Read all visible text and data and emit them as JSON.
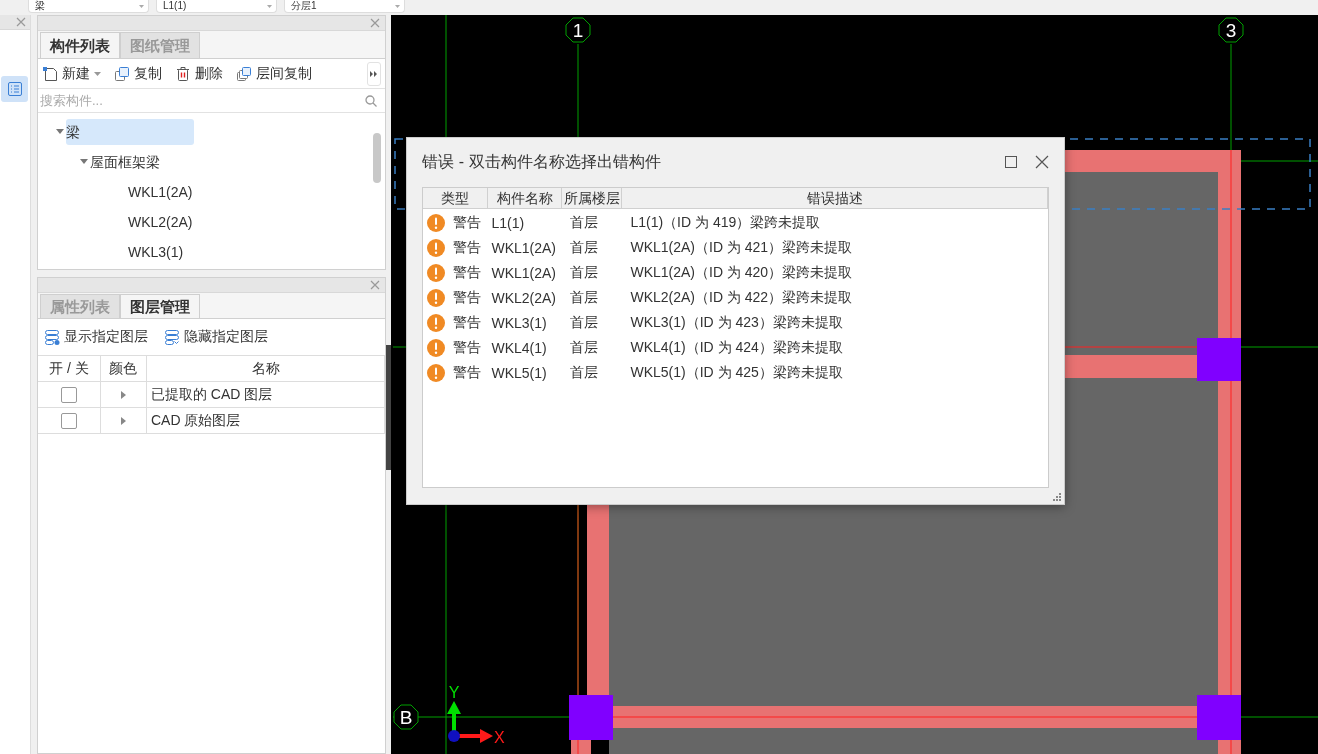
{
  "toolbar": {
    "dropdowns": [
      "梁",
      "L1(1)",
      "分层1"
    ]
  },
  "component_panel": {
    "tabs": [
      {
        "label": "构件列表",
        "selected": true
      },
      {
        "label": "图纸管理",
        "selected": false
      }
    ],
    "actions": [
      {
        "label": "新建",
        "kind": "new"
      },
      {
        "label": "复制",
        "kind": "copy"
      },
      {
        "label": "删除",
        "kind": "delete"
      },
      {
        "label": "层间复制",
        "kind": "floor-copy"
      }
    ],
    "search": {
      "placeholder": "搜索构件..."
    },
    "tree": [
      {
        "label": "梁",
        "expanded": true,
        "selected": true,
        "children": [
          {
            "label": "屋面框架梁",
            "expanded": true,
            "selected": false,
            "children": [
              {
                "label": "WKL1(2A)",
                "selected": false
              },
              {
                "label": "WKL2(2A)",
                "selected": false
              },
              {
                "label": "WKL3(1)",
                "selected": false
              }
            ]
          }
        ]
      }
    ]
  },
  "layer_panel": {
    "tabs": [
      {
        "label": "属性列表",
        "selected": false
      },
      {
        "label": "图层管理",
        "selected": true
      }
    ],
    "actions": [
      {
        "label": "显示指定图层",
        "kind": "show"
      },
      {
        "label": "隐藏指定图层",
        "kind": "hide"
      }
    ],
    "columns": [
      "开 / 关",
      "颜色",
      "名称"
    ],
    "rows": [
      {
        "on": false,
        "name": "已提取的 CAD 图层"
      },
      {
        "on": false,
        "name": "CAD 原始图层"
      }
    ]
  },
  "canvas": {
    "grid_labels": [
      "1",
      "3",
      "B"
    ],
    "axis_labels": {
      "x": "X",
      "y": "Y"
    }
  },
  "error_dialog": {
    "title": "错误 - 双击构件名称选择出错构件",
    "columns": [
      "类型",
      "构件名称",
      "所属楼层",
      "错误描述"
    ],
    "rows": [
      {
        "type": "警告",
        "name": "L1(1)",
        "floor": "首层",
        "description": "L1(1)（ID 为 419）梁跨未提取"
      },
      {
        "type": "警告",
        "name": "WKL1(2A)",
        "floor": "首层",
        "description": "WKL1(2A)（ID 为 421）梁跨未提取"
      },
      {
        "type": "警告",
        "name": "WKL1(2A)",
        "floor": "首层",
        "description": "WKL1(2A)（ID 为 420）梁跨未提取"
      },
      {
        "type": "警告",
        "name": "WKL2(2A)",
        "floor": "首层",
        "description": "WKL2(2A)（ID 为 422）梁跨未提取"
      },
      {
        "type": "警告",
        "name": "WKL3(1)",
        "floor": "首层",
        "description": "WKL3(1)（ID 为 423）梁跨未提取"
      },
      {
        "type": "警告",
        "name": "WKL4(1)",
        "floor": "首层",
        "description": "WKL4(1)（ID 为 424）梁跨未提取"
      },
      {
        "type": "警告",
        "name": "WKL5(1)",
        "floor": "首层",
        "description": "WKL5(1)（ID 为 425）梁跨未提取"
      }
    ]
  }
}
